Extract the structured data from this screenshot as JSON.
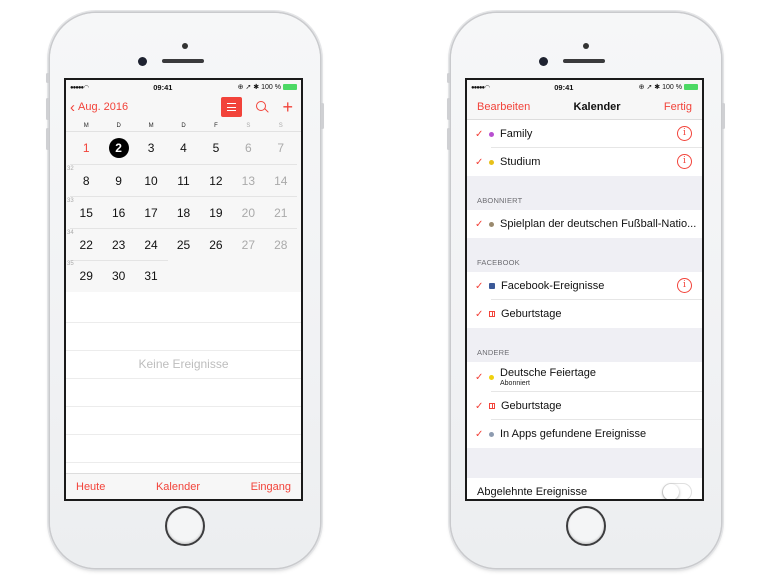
{
  "status_bar": {
    "signal": "●●●●● ",
    "wifi": "wifi-icon",
    "time": "09:41",
    "battery_text": "100 %"
  },
  "left": {
    "nav": {
      "back_label": "Aug. 2016",
      "back_icon": "chevron-left-icon",
      "list_icon": "list-view-icon",
      "search_icon": "search-icon",
      "add_icon": "plus-icon"
    },
    "weekdays": [
      "M",
      "D",
      "M",
      "D",
      "F",
      "S",
      "S"
    ],
    "weeks": [
      {
        "number": "",
        "days": [
          "1",
          "2",
          "3",
          "4",
          "5",
          "6",
          "7"
        ]
      },
      {
        "number": "32",
        "days": [
          "8",
          "9",
          "10",
          "11",
          "12",
          "13",
          "14"
        ]
      },
      {
        "number": "33",
        "days": [
          "15",
          "16",
          "17",
          "18",
          "19",
          "20",
          "21"
        ]
      },
      {
        "number": "34",
        "days": [
          "22",
          "23",
          "24",
          "25",
          "26",
          "27",
          "28"
        ]
      },
      {
        "number": "35",
        "days": [
          "29",
          "30",
          "31"
        ]
      }
    ],
    "selected_day": "2",
    "no_events": "Keine Ereignisse",
    "tabbar": {
      "today": "Heute",
      "calendars": "Kalender",
      "inbox": "Eingang"
    }
  },
  "right": {
    "nav": {
      "edit": "Bearbeiten",
      "title": "Kalender",
      "done": "Fertig"
    },
    "top_rows": [
      {
        "label": "Family",
        "color": "#b84fd0",
        "info": true
      },
      {
        "label": "Studium",
        "color": "#e7c019",
        "info": true
      }
    ],
    "sections": [
      {
        "header": "ABONNIERT",
        "rows": [
          {
            "label": "Spielplan der deutschen Fußball-Natio...",
            "color": "#9a8a6e"
          }
        ]
      },
      {
        "header": "FACEBOOK",
        "rows": [
          {
            "label": "Facebook-Ereignisse",
            "icon": "facebook-icon",
            "info": true
          },
          {
            "label": "Geburtstage",
            "icon": "gift-icon"
          }
        ]
      },
      {
        "header": "ANDERE",
        "rows": [
          {
            "label": "Deutsche Feiertage",
            "sub": "Abonniert",
            "color": "#f0d10e"
          },
          {
            "label": "Geburtstage",
            "icon": "gift-icon"
          },
          {
            "label": "In Apps gefundene Ereignisse",
            "color": "#8d9bb0"
          }
        ]
      }
    ],
    "declined": {
      "label": "Abgelehnte Ereignisse",
      "enabled": false
    }
  },
  "colors": {
    "accent": "#f2433a",
    "battery": "#4cd964"
  }
}
